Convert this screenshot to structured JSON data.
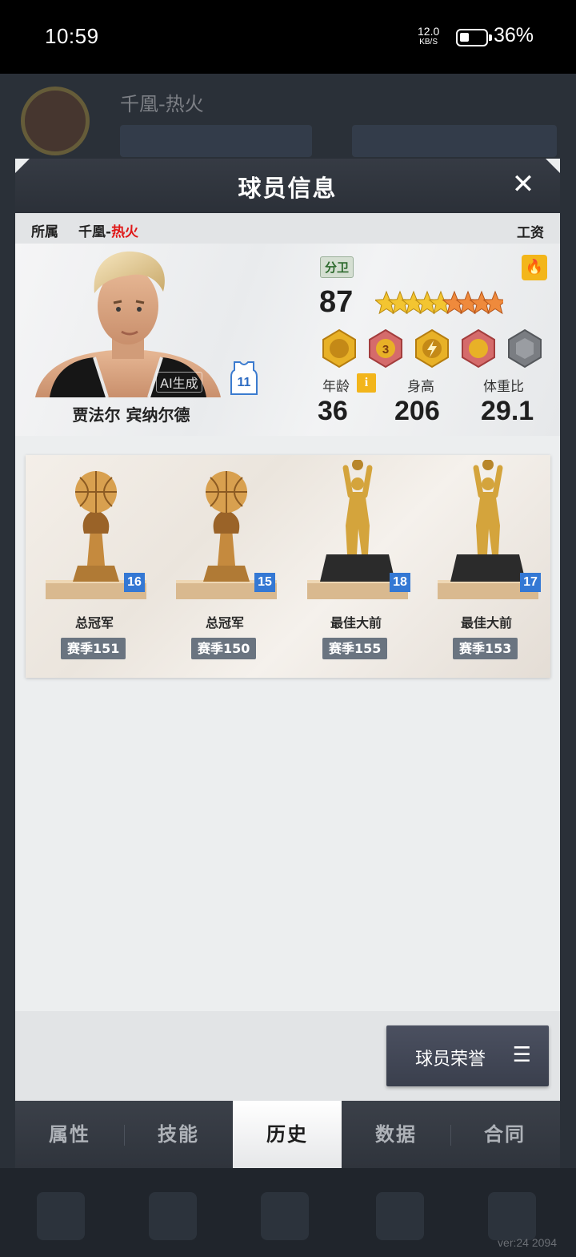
{
  "status_bar": {
    "time": "10:59",
    "net_speed": "12.0",
    "net_unit": "KB/S",
    "battery": "36%"
  },
  "background": {
    "team_name": "千凰-热火",
    "version": "ver:24 2094"
  },
  "modal": {
    "title": "球员信息",
    "close_icon": "close-icon"
  },
  "owner": {
    "label": "所属",
    "team_prefix": "千凰-",
    "team_highlight": "热火",
    "salary_label": "工资"
  },
  "player": {
    "name": "贾法尔 宾纳尔德",
    "ai_tag": "AI生成",
    "jersey_number": "11",
    "position": "分卫",
    "rating": "87",
    "stars_gold": 5,
    "stars_orange": 4,
    "age_label": "年龄",
    "age": "36",
    "info_icon": "i",
    "height_label": "身高",
    "height": "206",
    "weight_ratio_label": "体重比",
    "weight_ratio": "29.1"
  },
  "trophies": [
    {
      "name": "总冠军",
      "count": "16",
      "season": "赛季151",
      "type": "champion"
    },
    {
      "name": "总冠军",
      "count": "15",
      "season": "赛季150",
      "type": "champion"
    },
    {
      "name": "最佳大前",
      "count": "18",
      "season": "赛季155",
      "type": "player"
    },
    {
      "name": "最佳大前",
      "count": "17",
      "season": "赛季153",
      "type": "player"
    }
  ],
  "honor_button": {
    "label": "球员荣誉",
    "icon": "menu-icon"
  },
  "tabs": [
    {
      "label": "属性",
      "active": false
    },
    {
      "label": "技能",
      "active": false
    },
    {
      "label": "历史",
      "active": true
    },
    {
      "label": "数据",
      "active": false
    },
    {
      "label": "合同",
      "active": false
    }
  ],
  "colors": {
    "accent_red": "#e01818",
    "trophy_count_blue": "#3478d4",
    "season_tag": "#6a7480"
  }
}
